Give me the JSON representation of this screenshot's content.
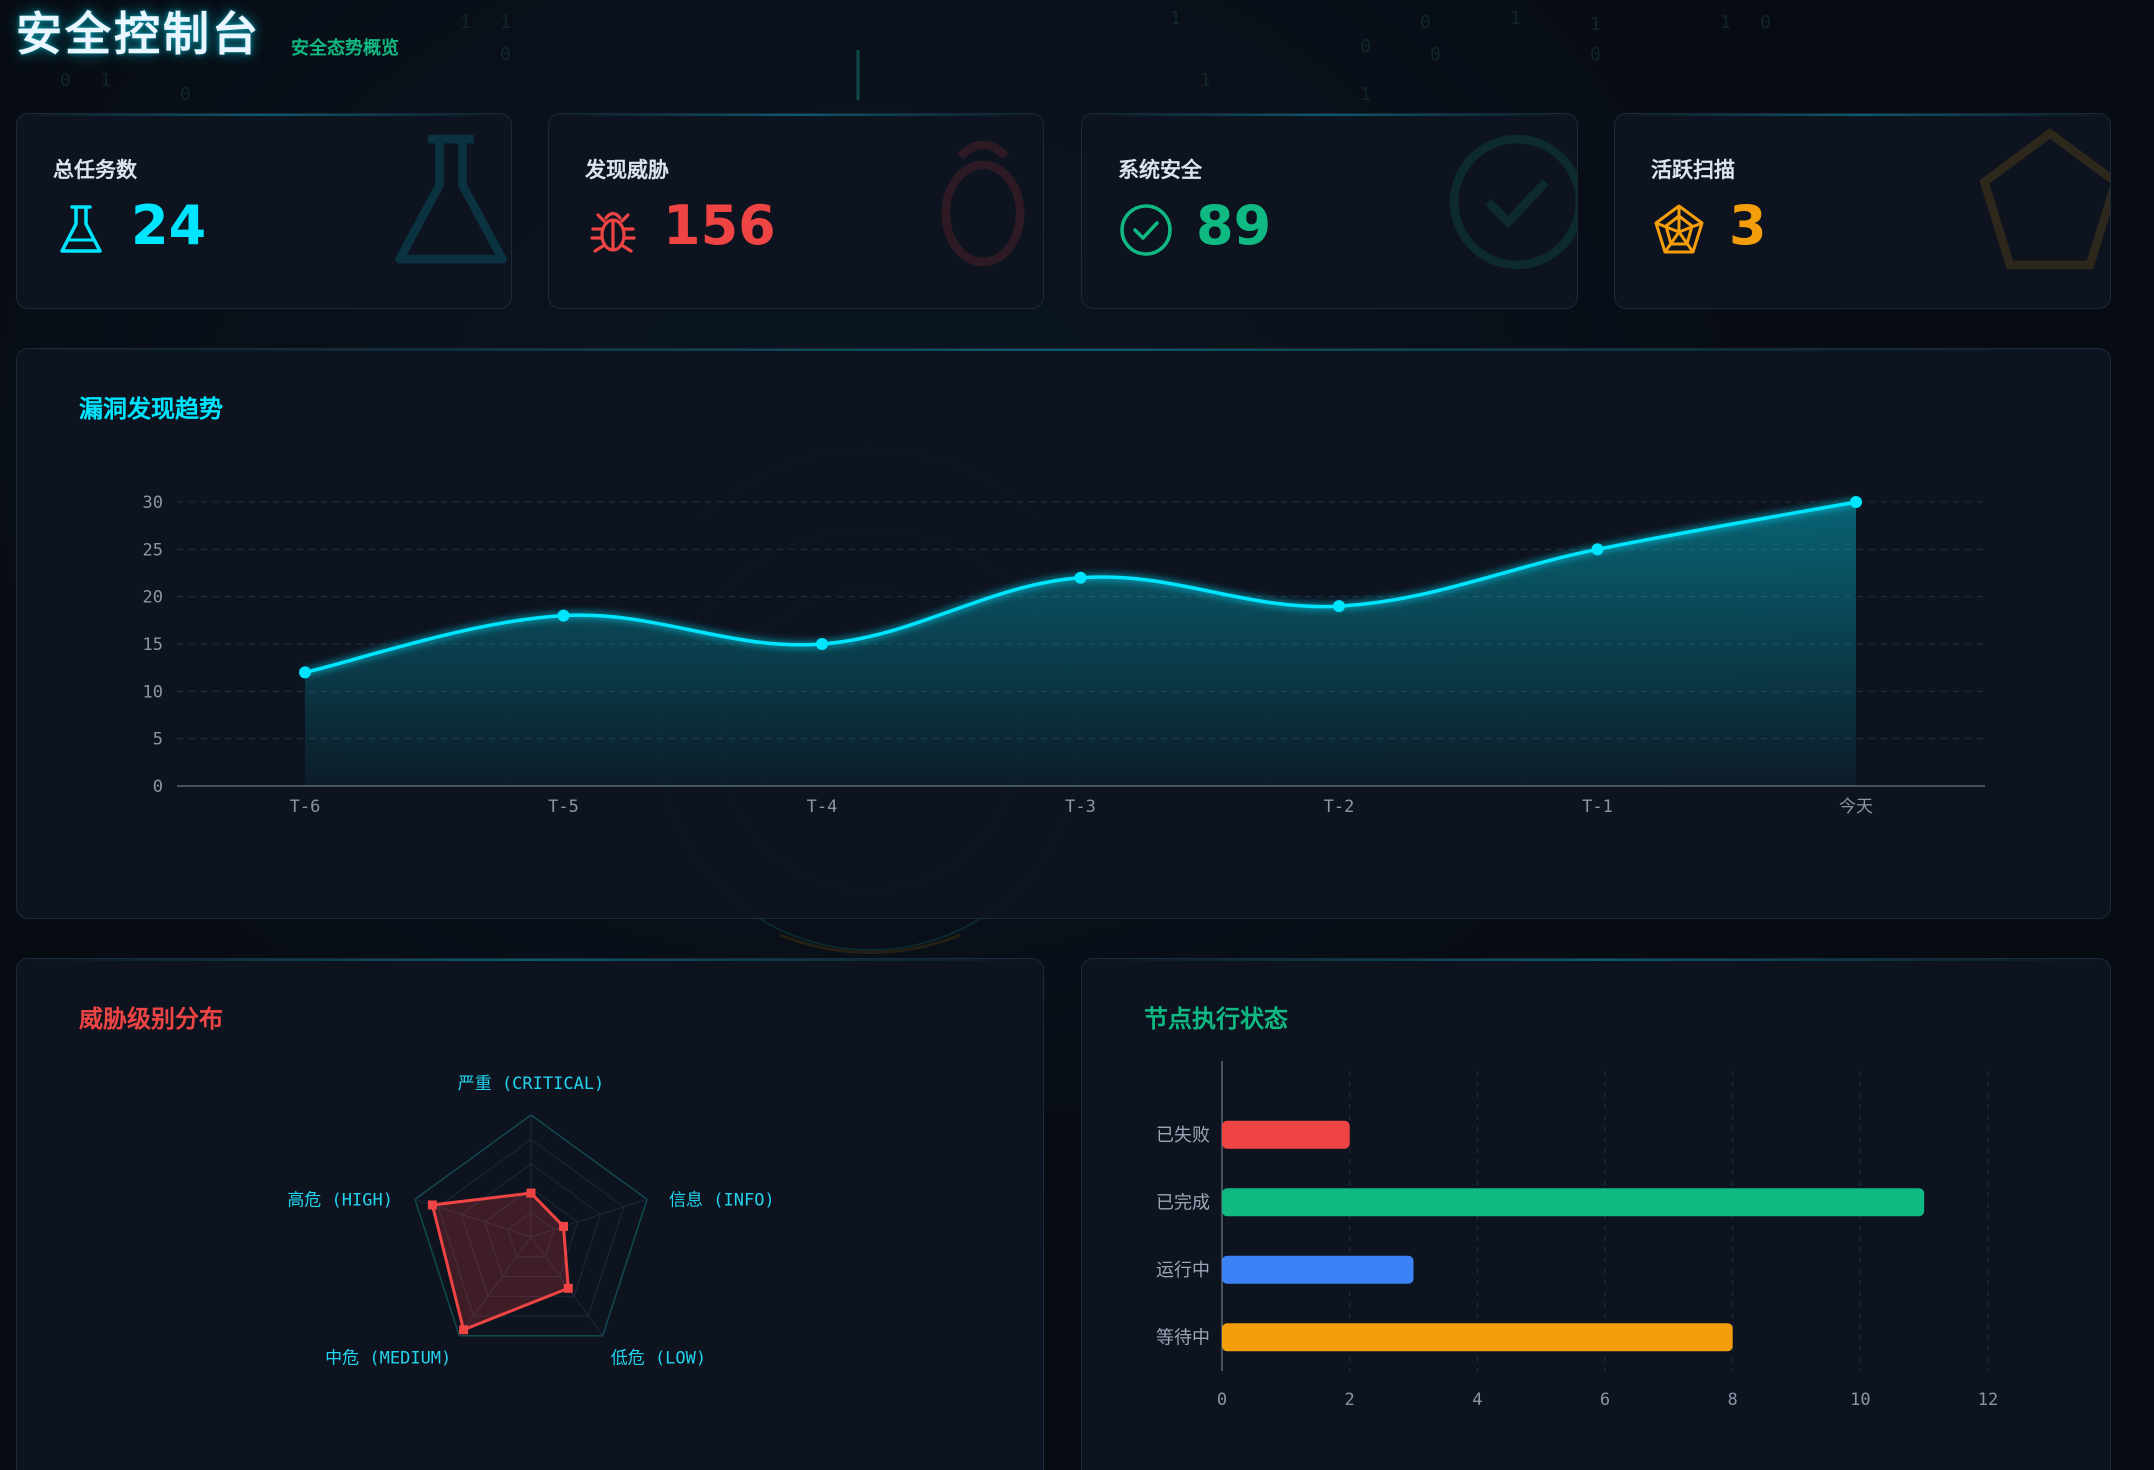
{
  "header": {
    "title": "安全控制台",
    "subtitle": "安全态势概览"
  },
  "stats": [
    {
      "label": "总任务数",
      "value": "24",
      "icon": "flask-icon",
      "color": "#00e5ff"
    },
    {
      "label": "发现威胁",
      "value": "156",
      "icon": "bug-icon",
      "color": "#ef4444"
    },
    {
      "label": "系统安全",
      "value": "89",
      "icon": "check-circle-icon",
      "color": "#10b981"
    },
    {
      "label": "活跃扫描",
      "value": "3",
      "icon": "radar-icon",
      "color": "#f59e0b"
    }
  ],
  "trend": {
    "title": "漏洞发现趋势",
    "title_color": "#00e5ff",
    "chart_data": {
      "type": "area",
      "categories": [
        "T-6",
        "T-5",
        "T-4",
        "T-3",
        "T-2",
        "T-1",
        "今天"
      ],
      "values": [
        12,
        18,
        15,
        22,
        19,
        25,
        30
      ],
      "yticks": [
        0,
        5,
        10,
        15,
        20,
        25,
        30
      ],
      "ylim": [
        0,
        30
      ],
      "grid": true,
      "color": "#00e5ff"
    }
  },
  "threat": {
    "title": "威胁级别分布",
    "title_color": "#ef4444",
    "chart_data": {
      "type": "radar",
      "axes": [
        "严重 (CRITICAL)",
        "信息 (INFO)",
        "低危 (LOW)",
        "中危 (MEDIUM)",
        "高危 (HIGH)"
      ],
      "values": [
        0.36,
        0.28,
        0.52,
        0.94,
        0.85
      ],
      "max": 1,
      "color": "#ef4444",
      "label_color": "#22d3ee"
    }
  },
  "nodes": {
    "title": "节点执行状态",
    "title_color": "#10b981",
    "chart_data": {
      "type": "bar",
      "orientation": "horizontal",
      "categories": [
        "已失败",
        "已完成",
        "运行中",
        "等待中"
      ],
      "values": [
        2,
        11,
        3,
        8
      ],
      "colors": [
        "#ef4444",
        "#10b981",
        "#3b82f6",
        "#f59e0b"
      ],
      "xticks": [
        0,
        2,
        4,
        6,
        8,
        10,
        12
      ],
      "xlim": [
        0,
        12
      ]
    }
  }
}
